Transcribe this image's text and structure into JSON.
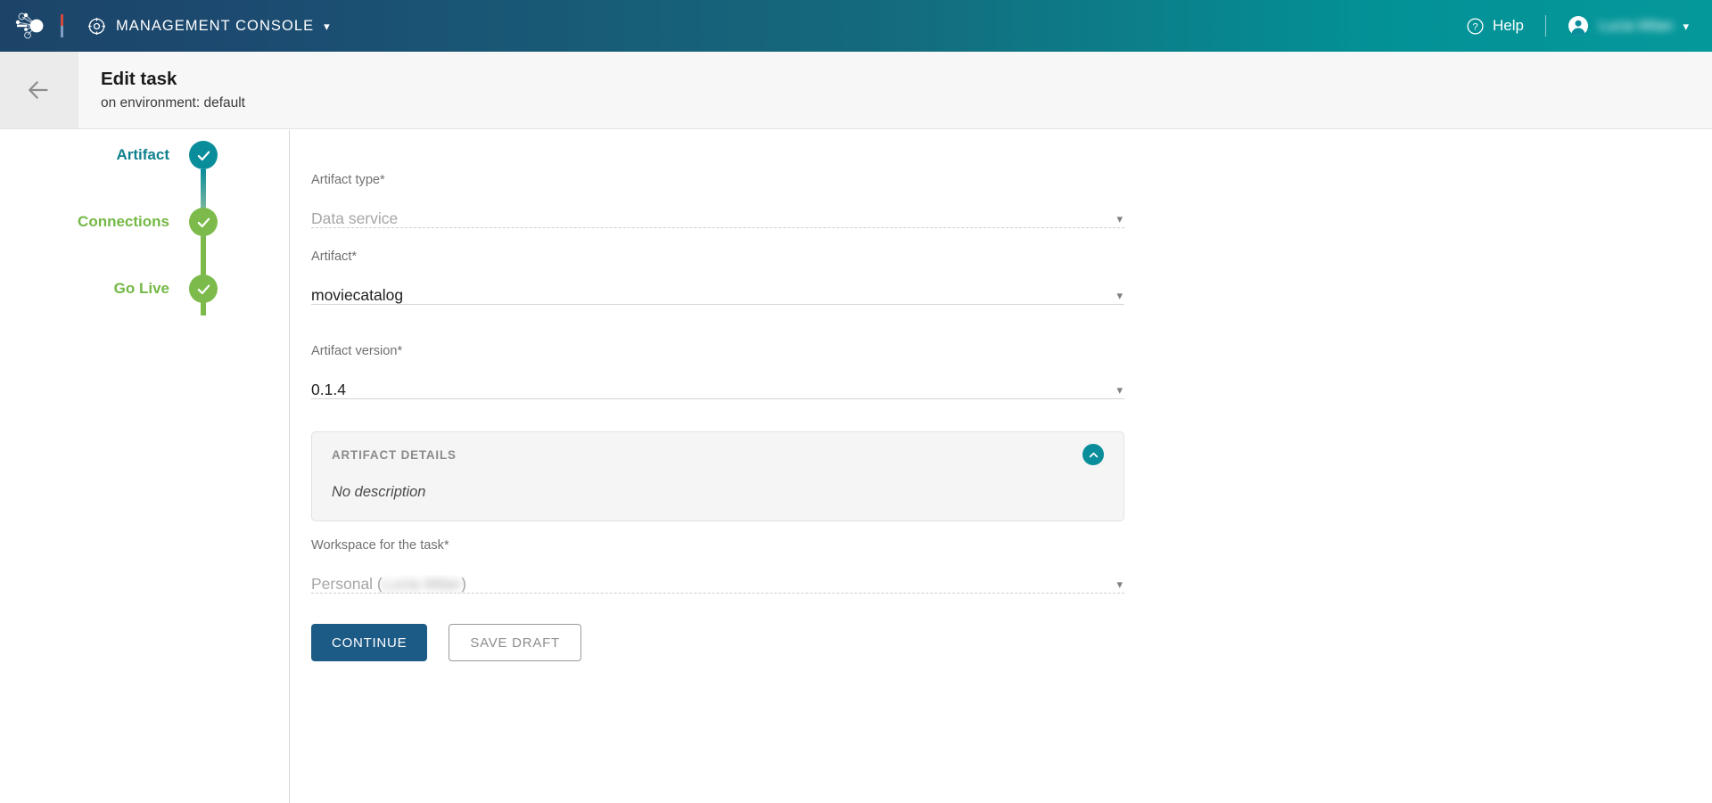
{
  "topbar": {
    "logo_icon": "network-nodes-logo",
    "console_icon": "compass-target-icon",
    "console_label": "MANAGEMENT CONSOLE",
    "console_chevron": "chevron-down-icon",
    "help_icon": "question-circle-icon",
    "help_label": "Help",
    "user_icon": "user-avatar-icon",
    "user_name": "Lucia Milan",
    "user_chevron": "chevron-down-icon",
    "gradient_start": "#1c4468",
    "gradient_end": "#05989b"
  },
  "subheader": {
    "back_icon": "arrow-left-icon",
    "title": "Edit task",
    "subtitle": "on environment: default"
  },
  "stepper": {
    "steps": [
      {
        "label": "Artifact",
        "state": "active",
        "color": "#10818f",
        "circle_color": "#0a8d9b",
        "icon": "check-icon"
      },
      {
        "label": "Connections",
        "state": "completed",
        "color": "#74b845",
        "circle_color": "#7cbb4b",
        "icon": "check-icon"
      },
      {
        "label": "Go Live",
        "state": "completed",
        "color": "#74b845",
        "circle_color": "#7cbb4b",
        "icon": "check-icon"
      }
    ]
  },
  "form": {
    "fields": [
      {
        "label": "Artifact type*",
        "value": "Data service",
        "disabled": true,
        "underline": "dotted",
        "chevron": "chevron-down-icon"
      },
      {
        "label": "Artifact*",
        "value": "moviecatalog",
        "disabled": false,
        "underline": "solid",
        "chevron": "chevron-down-icon"
      },
      {
        "label": "Artifact version*",
        "value": "0.1.4",
        "disabled": false,
        "underline": "solid",
        "chevron": "chevron-down-icon"
      }
    ],
    "details_panel": {
      "title": "ARTIFACT DETAILS",
      "collapse_icon": "chevron-up-icon",
      "body": "No description"
    },
    "workspace_field": {
      "label": "Workspace for the task*",
      "value_prefix": "Personal (",
      "value_redacted": "Lucia Milan",
      "value_suffix": ")",
      "disabled": true,
      "underline": "dotted",
      "chevron": "chevron-down-icon"
    },
    "buttons": {
      "continue_label": "CONTINUE",
      "save_draft_label": "SAVE DRAFT",
      "continue_color": "#1d5b87"
    }
  }
}
